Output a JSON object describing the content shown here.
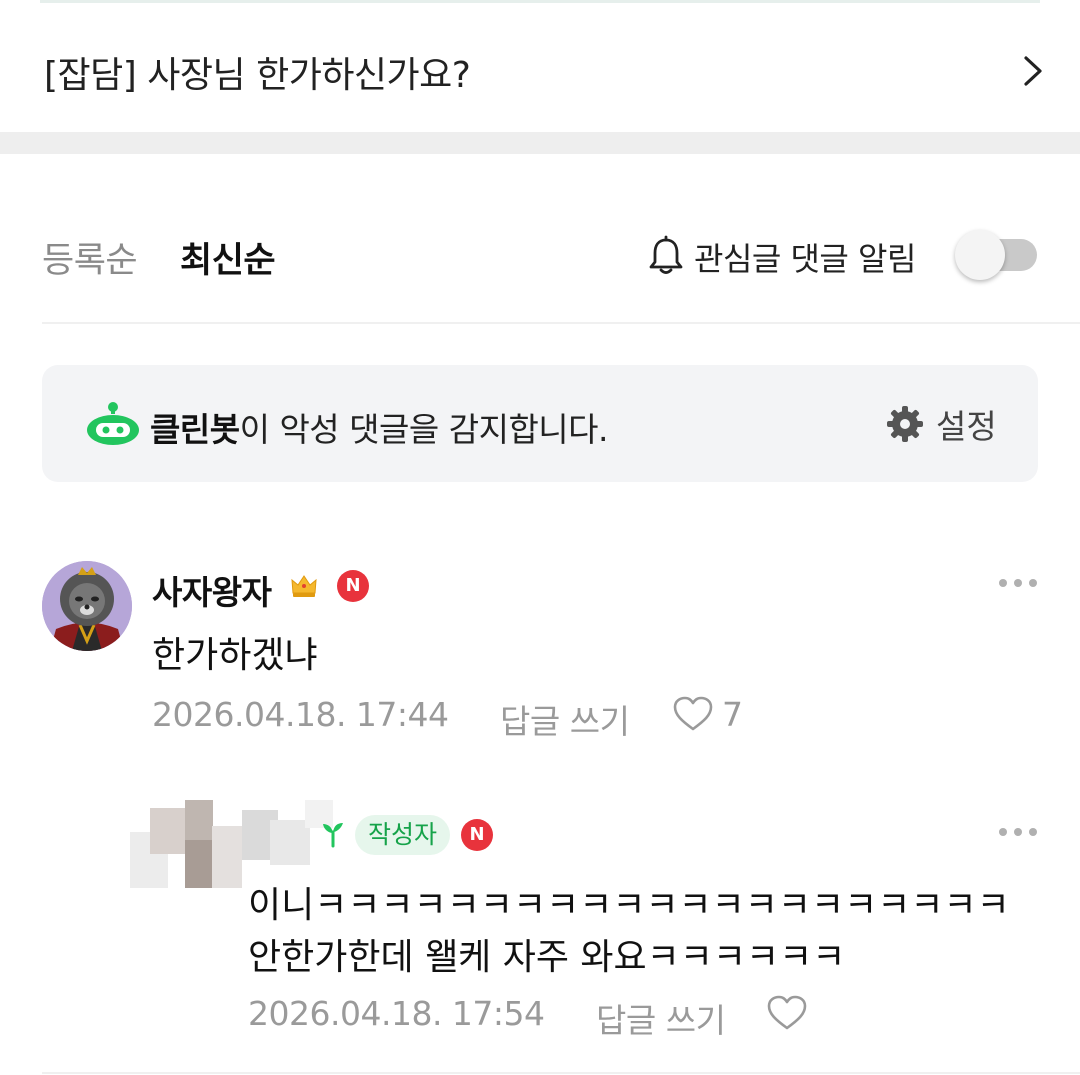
{
  "post": {
    "title": "[잡담] 사장님 한가하신가요?"
  },
  "sort": {
    "registered": "등록순",
    "latest": "최신순"
  },
  "notify": {
    "label": "관심글 댓글 알림",
    "enabled": false
  },
  "cleanbot": {
    "name": "클린봇",
    "message": "이 악성 댓글을 감지합니다.",
    "settings": "설정"
  },
  "comments": [
    {
      "nickname": "사자왕자",
      "text": "한가하겠냐",
      "date": "2026.04.18. 17:44",
      "reply_label": "답글 쓰기",
      "likes": "7",
      "badge": "N"
    },
    {
      "nickname": "",
      "author_badge": "작성자",
      "lines": [
        "이니ㅋㅋㅋㅋㅋㅋㅋㅋㅋㅋㅋㅋㅋㅋㅋㅋㅋㅋㅋㅋㅋ",
        "안한가한데 왤케 자주 와요ㅋㅋㅋㅋㅋㅋ"
      ],
      "date": "2026.04.18. 17:54",
      "reply_label": "답글 쓰기",
      "badge": "N"
    }
  ],
  "colors": {
    "accent_green": "#22c55e",
    "badge_red": "#e8333c",
    "author_green": "#16a34a"
  }
}
